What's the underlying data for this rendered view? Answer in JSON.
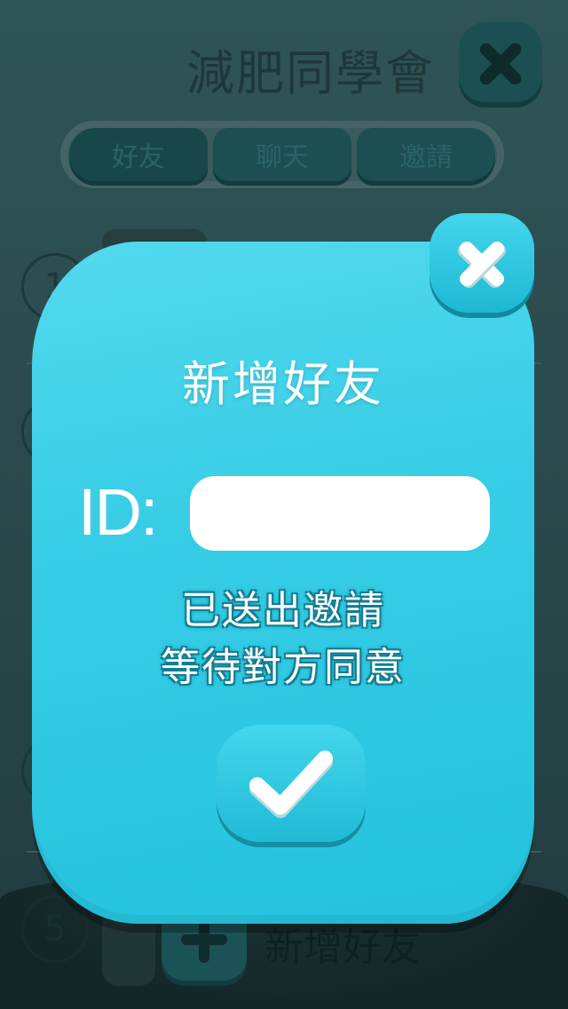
{
  "background": {
    "title": "減肥同學會",
    "tabs": [
      {
        "label": "好友"
      },
      {
        "label": "聊天"
      },
      {
        "label": "邀請"
      }
    ],
    "ranks": [
      "1",
      "5"
    ],
    "add_friend_label": "新增好友",
    "small_text": "32"
  },
  "dialog": {
    "title": "新增好友",
    "id_label": "ID:",
    "id_value": "",
    "status_line1": "已送出邀請",
    "status_line2": "等待對方同意",
    "close_icon": "close-icon",
    "confirm_icon": "checkmark-icon"
  },
  "colors": {
    "dialog_bg": "#38cde6",
    "overlay_bg": "#284749",
    "text_white": "#ffffff"
  }
}
